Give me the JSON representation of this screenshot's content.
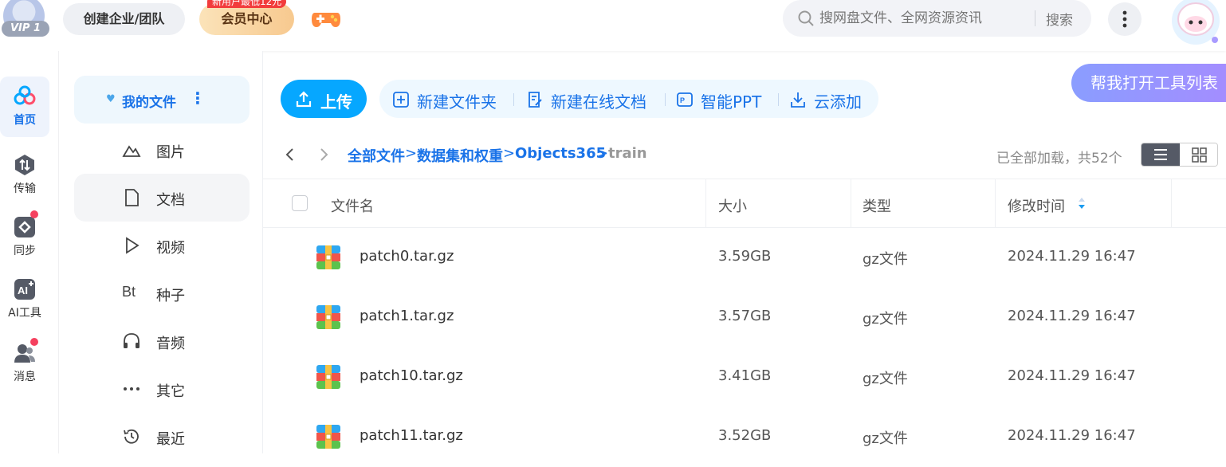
{
  "header": {
    "vip_badge": "VIP 1",
    "team_button": "创建企业/团队",
    "vip_center_tag": "新用户最低12元",
    "vip_center_label": "会员中心",
    "search_placeholder": "搜网盘文件、全网资源资讯",
    "search_button": "搜索"
  },
  "leftnav": {
    "items": [
      {
        "label": "首页",
        "icon": "home-cloud-icon",
        "active": true
      },
      {
        "label": "传输",
        "icon": "transfer-icon"
      },
      {
        "label": "同步",
        "icon": "sync-icon",
        "dot": true
      },
      {
        "label": "AI工具",
        "icon": "ai-tools-icon"
      },
      {
        "label": "消息",
        "icon": "messages-icon",
        "dot": true
      }
    ]
  },
  "sidebar": {
    "header": "我的文件",
    "items": [
      {
        "label": "图片",
        "icon": "image-icon"
      },
      {
        "label": "文档",
        "icon": "document-icon",
        "selected": true
      },
      {
        "label": "视频",
        "icon": "video-icon"
      },
      {
        "label": "种子",
        "icon": "torrent-icon",
        "icon_text": "Bt"
      },
      {
        "label": "音频",
        "icon": "headphones-icon"
      },
      {
        "label": "其它",
        "icon": "more-dots-icon"
      },
      {
        "label": "最近",
        "icon": "recent-clock-icon"
      }
    ]
  },
  "toolbar": {
    "upload": "上传",
    "new_folder": "新建文件夹",
    "new_online_doc": "新建在线文档",
    "smart_ppt": "智能PPT",
    "cloud_add": "云添加",
    "assistant": "帮我打开工具列表"
  },
  "breadcrumb": {
    "items": [
      "全部文件",
      "数据集和权重",
      "Objects365",
      "train"
    ],
    "count_text": "已全部加载，共52个"
  },
  "table": {
    "headers": {
      "name": "文件名",
      "size": "大小",
      "type": "类型",
      "modified": "修改时间"
    },
    "rows": [
      {
        "name": "patch0.tar.gz",
        "size": "3.59GB",
        "type": "gz文件",
        "modified": "2024.11.29 16:47"
      },
      {
        "name": "patch1.tar.gz",
        "size": "3.57GB",
        "type": "gz文件",
        "modified": "2024.11.29 16:47"
      },
      {
        "name": "patch10.tar.gz",
        "size": "3.41GB",
        "type": "gz文件",
        "modified": "2024.11.29 16:47"
      },
      {
        "name": "patch11.tar.gz",
        "size": "3.52GB",
        "type": "gz文件",
        "modified": "2024.11.29 16:47"
      }
    ]
  },
  "colors": {
    "accent": "#1a73e8",
    "upload_button": "#06a7ff",
    "red_dot": "#f5415f"
  }
}
